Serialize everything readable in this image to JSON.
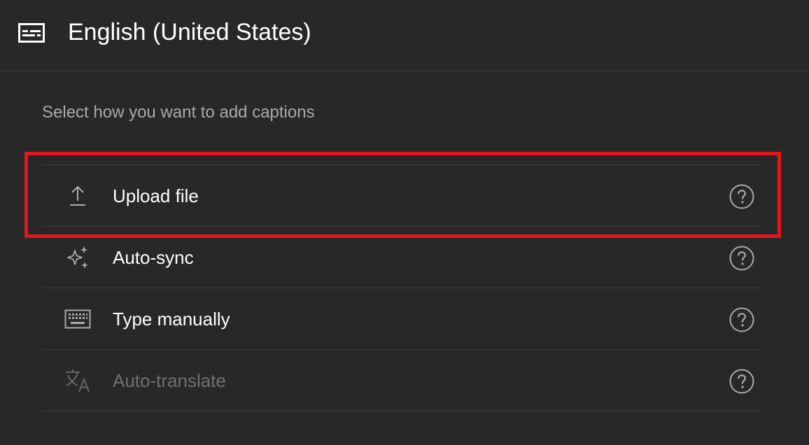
{
  "header": {
    "icon": "closed-captions-icon",
    "title": "English (United States)"
  },
  "subtitle": "Select how you want to add captions",
  "options": [
    {
      "label": "Upload file",
      "icon": "upload-icon",
      "enabled": true,
      "highlighted": true
    },
    {
      "label": "Auto-sync",
      "icon": "sparkle-icon",
      "enabled": true
    },
    {
      "label": "Type manually",
      "icon": "keyboard-icon",
      "enabled": true
    },
    {
      "label": "Auto-translate",
      "icon": "translate-icon",
      "enabled": false
    }
  ],
  "colors": {
    "background": "#282828",
    "text": "#ffffff",
    "muted_text": "#aaaaaa",
    "disabled_text": "#717171",
    "divider": "#3e3e3e",
    "highlight_border": "#e3161c"
  }
}
